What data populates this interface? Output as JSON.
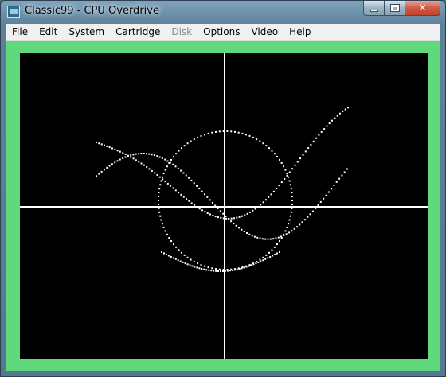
{
  "window": {
    "title": "Classic99 - CPU Overdrive",
    "app_icon": "ti99-app-icon",
    "controls": {
      "minimize_icon": "minimize-icon",
      "maximize_icon": "maximize-icon",
      "close_icon": "close-icon",
      "close_glyph": "✕"
    }
  },
  "menu": {
    "items": [
      {
        "label": "File",
        "enabled": true
      },
      {
        "label": "Edit",
        "enabled": true
      },
      {
        "label": "System",
        "enabled": true
      },
      {
        "label": "Cartridge",
        "enabled": true
      },
      {
        "label": "Disk",
        "enabled": false
      },
      {
        "label": "Options",
        "enabled": true
      },
      {
        "label": "Video",
        "enabled": true
      },
      {
        "label": "Help",
        "enabled": true
      }
    ]
  },
  "colors": {
    "border_green": "#5fd97b",
    "screen_bg": "#000000",
    "pixel": "#ffffff"
  }
}
